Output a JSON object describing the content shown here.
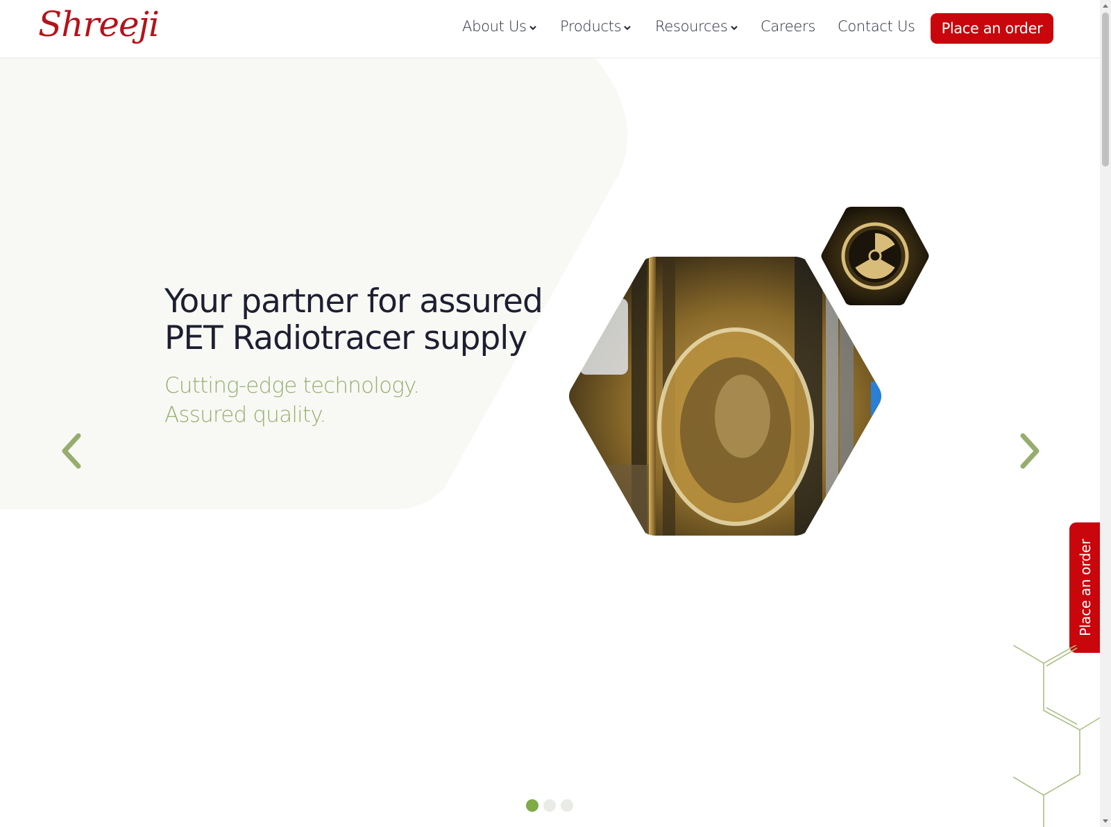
{
  "brand": {
    "logo_text": "Shreeji",
    "accent_color": "#c8060c",
    "secondary_color": "#96ad6e"
  },
  "nav": {
    "items": [
      {
        "label": "About Us",
        "has_dropdown": true
      },
      {
        "label": "Products",
        "has_dropdown": true
      },
      {
        "label": "Resources",
        "has_dropdown": true
      },
      {
        "label": "Careers",
        "has_dropdown": false
      },
      {
        "label": "Contact Us",
        "has_dropdown": false
      }
    ],
    "cta_label": "Place an order"
  },
  "hero": {
    "headline_line1": "Your partner for assured",
    "headline_line2": "PET Radiotracer supply",
    "sub_line1": "Cutting-edge technology.",
    "sub_line2": "Assured quality."
  },
  "carousel": {
    "slide_count": 3,
    "active_index": 0,
    "prev_icon": "chevron-left-icon",
    "next_icon": "chevron-right-icon"
  },
  "side_tab": {
    "label": "Place an order"
  }
}
